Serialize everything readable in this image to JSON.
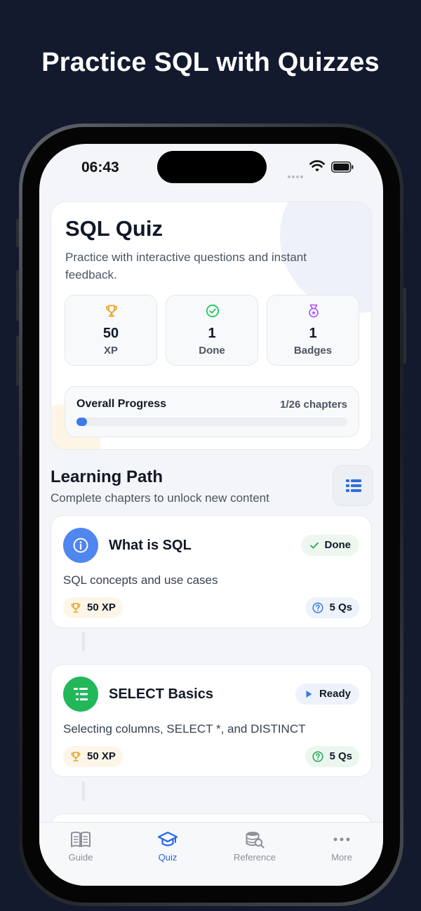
{
  "headline": "Practice SQL with Quizzes",
  "status_bar": {
    "time": "06:43"
  },
  "hero": {
    "title": "SQL Quiz",
    "subtitle": "Practice with interactive questions and instant feedback.",
    "stats": [
      {
        "icon": "trophy-icon",
        "value": "50",
        "label": "XP",
        "color": "#e8a423"
      },
      {
        "icon": "check-circle-icon",
        "value": "1",
        "label": "Done",
        "color": "#22c55e"
      },
      {
        "icon": "medal-icon",
        "value": "1",
        "label": "Badges",
        "color": "#a855f7"
      }
    ],
    "progress": {
      "title": "Overall Progress",
      "count": "1/26 chapters",
      "value": 0.038
    }
  },
  "learning_path": {
    "title": "Learning Path",
    "subtitle": "Complete chapters to unlock new content",
    "toggle_icon": "list-view-icon",
    "chapters": [
      {
        "title": "What is SQL",
        "description": "SQL concepts and use cases",
        "status": "Done",
        "xp": "50 XP",
        "questions": "5 Qs",
        "icon": "info-icon",
        "icon_color": "#4f86f0"
      },
      {
        "title": "SELECT Basics",
        "description": "Selecting columns, SELECT *, and DISTINCT",
        "status": "Ready",
        "xp": "50 XP",
        "questions": "5 Qs",
        "icon": "list-icon",
        "icon_color": "#22b85a"
      }
    ]
  },
  "tabs": [
    {
      "label": "Guide",
      "icon": "book-icon",
      "active": false
    },
    {
      "label": "Quiz",
      "icon": "graduation-cap-icon",
      "active": true
    },
    {
      "label": "Reference",
      "icon": "database-search-icon",
      "active": false
    },
    {
      "label": "More",
      "icon": "more-dots-icon",
      "active": false
    }
  ],
  "colors": {
    "accent": "#2563eb",
    "background": "#131a2e",
    "progress": "#3b7be9"
  }
}
